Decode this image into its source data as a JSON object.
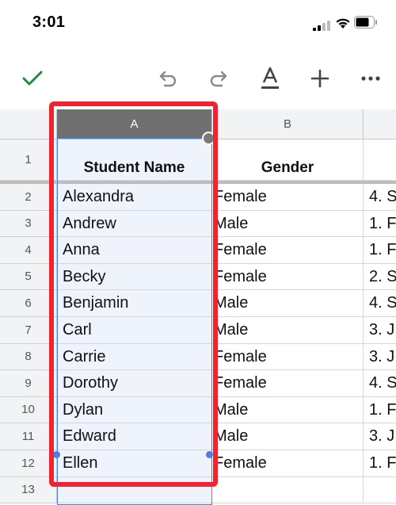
{
  "status_bar": {
    "time": "3:01"
  },
  "toolbar": {
    "icons": [
      "checkmark-icon",
      "undo-icon",
      "redo-icon",
      "text-format-icon",
      "plus-icon",
      "more-icon"
    ],
    "accent": "#1e8e3e"
  },
  "sheet": {
    "columns": [
      "A",
      "B"
    ],
    "header_row": {
      "row": "1",
      "a": "Student Name",
      "b": "Gender",
      "c": ""
    },
    "rows": [
      {
        "row": "2",
        "a": "Alexandra",
        "b": "Female",
        "c": "4. S"
      },
      {
        "row": "3",
        "a": "Andrew",
        "b": "Male",
        "c": "1. F"
      },
      {
        "row": "4",
        "a": "Anna",
        "b": "Female",
        "c": "1. F"
      },
      {
        "row": "5",
        "a": "Becky",
        "b": "Female",
        "c": "2. S"
      },
      {
        "row": "6",
        "a": "Benjamin",
        "b": "Male",
        "c": "4. S"
      },
      {
        "row": "7",
        "a": "Carl",
        "b": "Male",
        "c": "3. J"
      },
      {
        "row": "8",
        "a": "Carrie",
        "b": "Female",
        "c": "3. J"
      },
      {
        "row": "9",
        "a": "Dorothy",
        "b": "Female",
        "c": "4. S"
      },
      {
        "row": "10",
        "a": "Dylan",
        "b": "Male",
        "c": "1. F"
      },
      {
        "row": "11",
        "a": "Edward",
        "b": "Male",
        "c": "3. J"
      },
      {
        "row": "12",
        "a": "Ellen",
        "b": "Female",
        "c": "1. F"
      },
      {
        "row": "13",
        "a": "",
        "b": "",
        "c": ""
      }
    ],
    "selected_column": "A",
    "highlight_color": "#f0232e",
    "selection_color": "#4a7fe0"
  }
}
